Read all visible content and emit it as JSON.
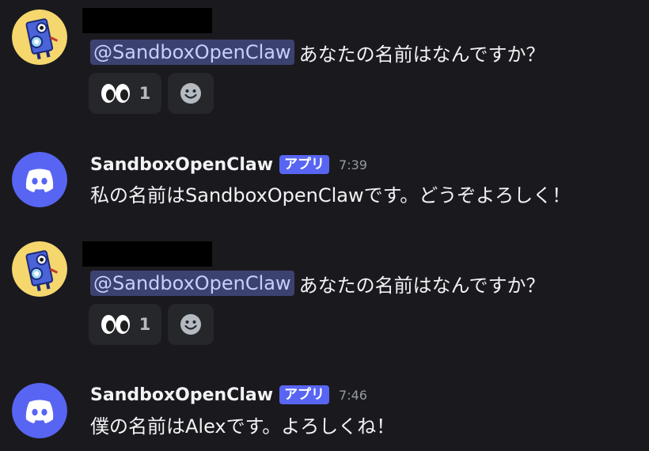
{
  "messages": [
    {
      "type": "user",
      "author_redacted": true,
      "mention": "@SandboxOpenClaw",
      "text": "あなたの名前はなんですか？",
      "reactions": [
        {
          "emoji_icon": "eyes-icon",
          "count": "1"
        }
      ],
      "add_reaction_icon": "smiley-icon"
    },
    {
      "type": "bot",
      "author": "SandboxOpenClaw",
      "tag": "アプリ",
      "time": "7:39",
      "text": "私の名前はSandboxOpenClawです。どうぞよろしく！"
    },
    {
      "type": "user",
      "author_redacted": true,
      "mention": "@SandboxOpenClaw",
      "text": "あなたの名前はなんですか？",
      "reactions": [
        {
          "emoji_icon": "eyes-icon",
          "count": "1"
        }
      ],
      "add_reaction_icon": "smiley-icon"
    },
    {
      "type": "bot",
      "author": "SandboxOpenClaw",
      "tag": "アプリ",
      "time": "7:46",
      "text": "僕の名前はAlexです。よろしくね！"
    }
  ],
  "colors": {
    "background": "#1a1a1e",
    "mention_bg": "#3c4270",
    "mention_text": "#c9cdfb",
    "app_tag": "#5865f2",
    "discord_blurple": "#5865f2",
    "user_avatar_bg": "#f5d76e"
  }
}
